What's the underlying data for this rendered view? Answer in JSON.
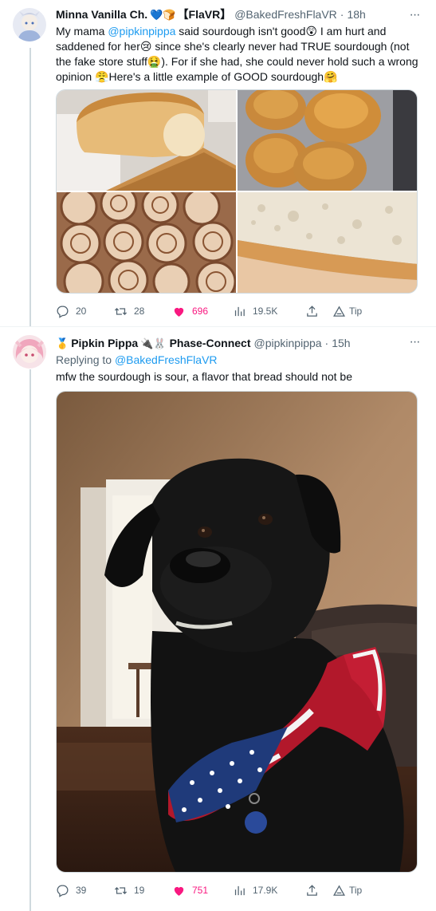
{
  "colors": {
    "accent": "#1d9bf0",
    "like": "#f91880",
    "muted": "#536471",
    "text": "#0f1419",
    "line": "#cfd9de"
  },
  "tweets": [
    {
      "display_name": "Minna Vanilla Ch.",
      "name_badges": "💙🍞",
      "name_tag": "【FlaVR】",
      "handle": "@BakedFreshFlaVR",
      "dot": "·",
      "time": "18h",
      "more_icon": "more-dots-icon",
      "text_parts": {
        "p1": "My mama ",
        "mention": "@pipkinpippa",
        "p2": " said sourdough isn't good😲 I am hurt and saddened for her😢 since she's clearly never had TRUE sourdough (not the fake store stuff🤮). For if she had, she could never hold such a wrong opinion 😤Here's a little example of GOOD sourdough🤗"
      },
      "media": [
        "bread loaf on cutting board",
        "glazed sourdough rolls",
        "cinnamon rolls on tray",
        "close-up of sourdough crumb"
      ],
      "stats": {
        "replies": "20",
        "retweets": "28",
        "likes": "696",
        "views": "19.5K",
        "tip": "Tip"
      }
    },
    {
      "display_name": "Pipkin Pippa",
      "name_badges_left": "🥇",
      "name_badges": "🔌🐰",
      "name_tag": "Phase-Connect",
      "handle": "@pipkinpippa",
      "dot": "·",
      "time": "15h",
      "more_icon": "more-dots-icon",
      "replying_prefix": "Replying to ",
      "replying_to": "@BakedFreshFlaVR",
      "text": "mfw the sourdough is sour, a flavor that bread should not be",
      "media": [
        "black dog wearing american flag bandana"
      ],
      "stats": {
        "replies": "39",
        "retweets": "19",
        "likes": "751",
        "views": "17.9K",
        "tip": "Tip"
      }
    }
  ]
}
